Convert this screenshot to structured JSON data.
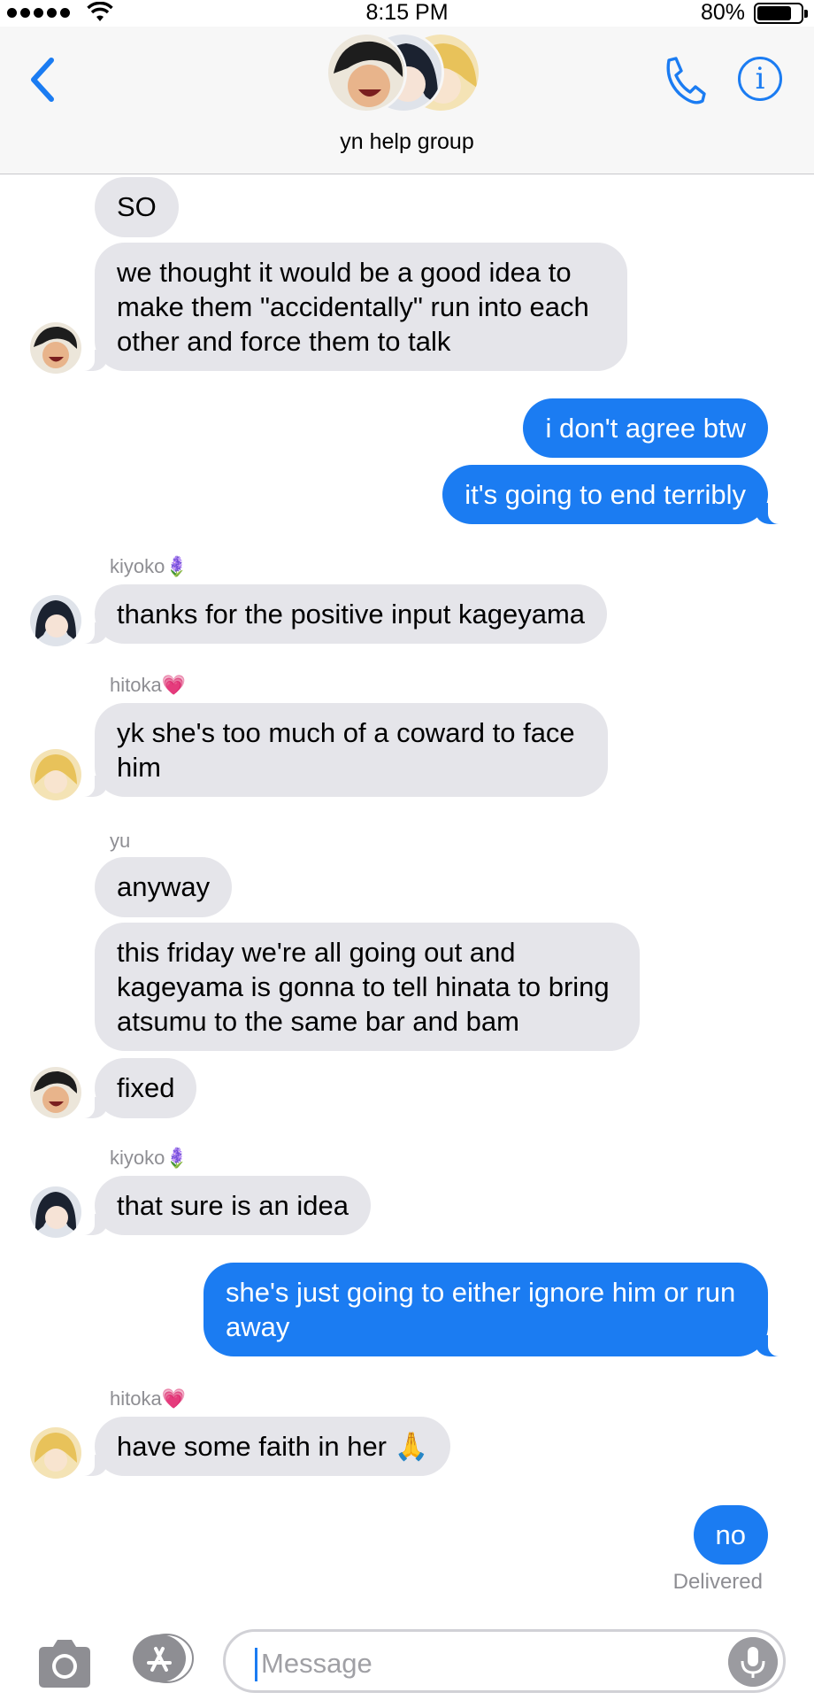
{
  "status_bar": {
    "time": "8:15 PM",
    "battery_percent": "80%",
    "battery_level": 0.8
  },
  "header": {
    "group_name": "yn help group",
    "back_icon": "chevron-left-icon",
    "call_icon": "phone-icon",
    "info_icon": "info-icon",
    "info_glyph": "i",
    "accent_color": "#1b7cf2"
  },
  "messages": [
    {
      "text": "SO"
    },
    {
      "text": "we thought it would be a good idea to make them \"accidentally\" run into each other and force them to talk"
    },
    {
      "text": "i don't agree btw"
    },
    {
      "text": "it's going to end terribly"
    },
    {
      "sender": "kiyoko",
      "sender_emoji": "🪻",
      "text": "thanks for the positive input kageyama"
    },
    {
      "sender": "hitoka",
      "sender_emoji": "💗",
      "text": "yk she's too much of a coward to face him"
    },
    {
      "sender": "yu",
      "text": "anyway"
    },
    {
      "text": "this friday we're all going out and kageyama is gonna to tell hinata to bring atsumu to the same bar and bam"
    },
    {
      "text": "fixed"
    },
    {
      "sender": "kiyoko",
      "sender_emoji": "🪻",
      "text": "that sure is an idea"
    },
    {
      "text": "she's just going to either ignore him or run away"
    },
    {
      "sender": "hitoka",
      "sender_emoji": "💗",
      "text": "have some faith in her 🙏"
    },
    {
      "text": "no"
    }
  ],
  "delivered_label": "Delivered",
  "input": {
    "placeholder": "Message"
  },
  "colors": {
    "outgoing": "#1b7cf2",
    "incoming": "#e5e5ea"
  }
}
